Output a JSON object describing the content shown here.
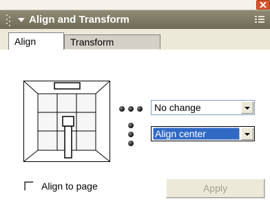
{
  "panel": {
    "title": "Align and Transform"
  },
  "tabs": [
    {
      "label": "Align",
      "active": true
    },
    {
      "label": "Transform",
      "active": false
    }
  ],
  "horizontal_align": {
    "value": "No change"
  },
  "vertical_align": {
    "value": "Align center"
  },
  "align_to_page": {
    "label": "Align to page",
    "checked": false
  },
  "apply_button": {
    "label": "Apply",
    "enabled": false
  },
  "icons": {
    "close": "close-icon",
    "collapse": "triangle-down-icon",
    "grip": "grip-icon",
    "menu": "panel-menu-icon",
    "horizontal_dots": "horizontal-dots-icon",
    "vertical_dots": "vertical-dots-icon"
  },
  "colors": {
    "titlebar": "#7f7a64",
    "close_button": "#d9542c",
    "selection": "#316ac5",
    "disabled_text": "#a3a08f"
  }
}
